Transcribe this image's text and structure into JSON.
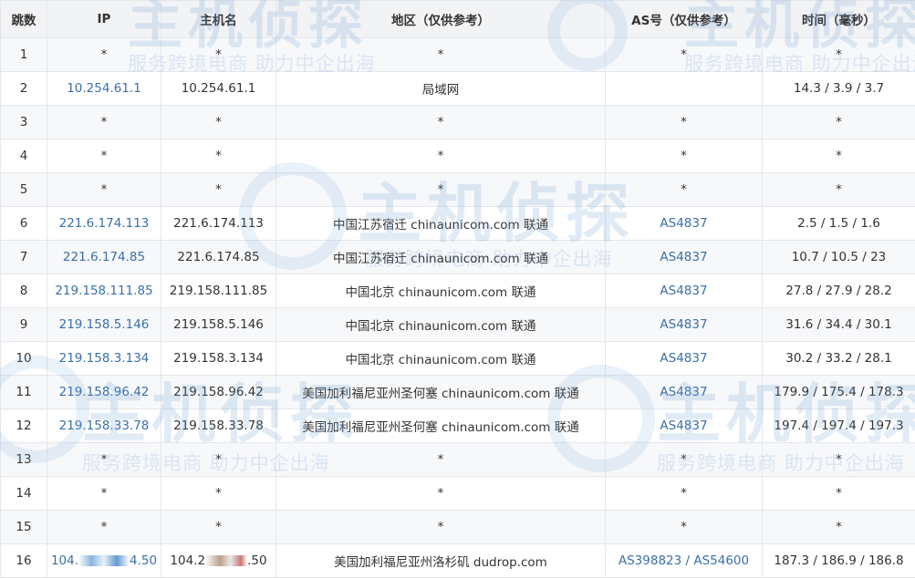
{
  "table": {
    "headers": {
      "hop": "跳数",
      "ip": "IP",
      "host": "主机名",
      "region": "地区（仅供参考）",
      "as": "AS号（仅供参考）",
      "time": "时间（毫秒）"
    },
    "rows": [
      {
        "hop": "1",
        "ip": "*",
        "host": "*",
        "region": "*",
        "as": [
          "*"
        ],
        "time": "*"
      },
      {
        "hop": "2",
        "ip": "10.254.61.1",
        "host": "10.254.61.1",
        "region": "局域网",
        "as": [],
        "time": "14.3 / 3.9 / 3.7"
      },
      {
        "hop": "3",
        "ip": "*",
        "host": "*",
        "region": "*",
        "as": [
          "*"
        ],
        "time": "*"
      },
      {
        "hop": "4",
        "ip": "*",
        "host": "*",
        "region": "*",
        "as": [
          "*"
        ],
        "time": "*"
      },
      {
        "hop": "5",
        "ip": "*",
        "host": "*",
        "region": "*",
        "as": [
          "*"
        ],
        "time": "*"
      },
      {
        "hop": "6",
        "ip": "221.6.174.113",
        "host": "221.6.174.113",
        "region": "中国江苏宿迁 chinaunicom.com 联通",
        "as": [
          "AS4837"
        ],
        "time": "2.5 / 1.5 / 1.6"
      },
      {
        "hop": "7",
        "ip": "221.6.174.85",
        "host": "221.6.174.85",
        "region": "中国江苏宿迁 chinaunicom.com 联通",
        "as": [
          "AS4837"
        ],
        "time": "10.7 / 10.5 / 23"
      },
      {
        "hop": "8",
        "ip": "219.158.111.85",
        "host": "219.158.111.85",
        "region": "中国北京 chinaunicom.com 联通",
        "as": [
          "AS4837"
        ],
        "time": "27.8 / 27.9 / 28.2"
      },
      {
        "hop": "9",
        "ip": "219.158.5.146",
        "host": "219.158.5.146",
        "region": "中国北京 chinaunicom.com 联通",
        "as": [
          "AS4837"
        ],
        "time": "31.6 / 34.4 / 30.1"
      },
      {
        "hop": "10",
        "ip": "219.158.3.134",
        "host": "219.158.3.134",
        "region": "中国北京 chinaunicom.com 联通",
        "as": [
          "AS4837"
        ],
        "time": "30.2 / 33.2 / 28.1"
      },
      {
        "hop": "11",
        "ip": "219.158.96.42",
        "host": "219.158.96.42",
        "region": "美国加利福尼亚州圣何塞 chinaunicom.com 联通",
        "as": [
          "AS4837"
        ],
        "time": "179.9 / 175.4 / 178.3"
      },
      {
        "hop": "12",
        "ip": "219.158.33.78",
        "host": "219.158.33.78",
        "region": "美国加利福尼亚州圣何塞 chinaunicom.com 联通",
        "as": [
          "AS4837"
        ],
        "time": "197.4 / 197.4 / 197.3"
      },
      {
        "hop": "13",
        "ip": "*",
        "host": "*",
        "region": "*",
        "as": [
          "*"
        ],
        "time": "*"
      },
      {
        "hop": "14",
        "ip": "*",
        "host": "*",
        "region": "*",
        "as": [
          "*"
        ],
        "time": "*"
      },
      {
        "hop": "15",
        "ip": "*",
        "host": "*",
        "region": "*",
        "as": [
          "*"
        ],
        "time": "*"
      },
      {
        "hop": "16",
        "ip_prefix": "104.",
        "ip_suffix": "4.50",
        "host_prefix": "104.2",
        "host_suffix": ".50",
        "region": "美国加利福尼亚州洛杉矶 dudrop.com",
        "as": [
          "AS398823",
          "AS54600"
        ],
        "time": "187.3 / 186.9 / 186.8",
        "redacted": true
      }
    ]
  },
  "as_separator": " / ",
  "watermark": {
    "brand": "主机侦探",
    "tagline": "服务跨境电商 助力中企出海"
  }
}
